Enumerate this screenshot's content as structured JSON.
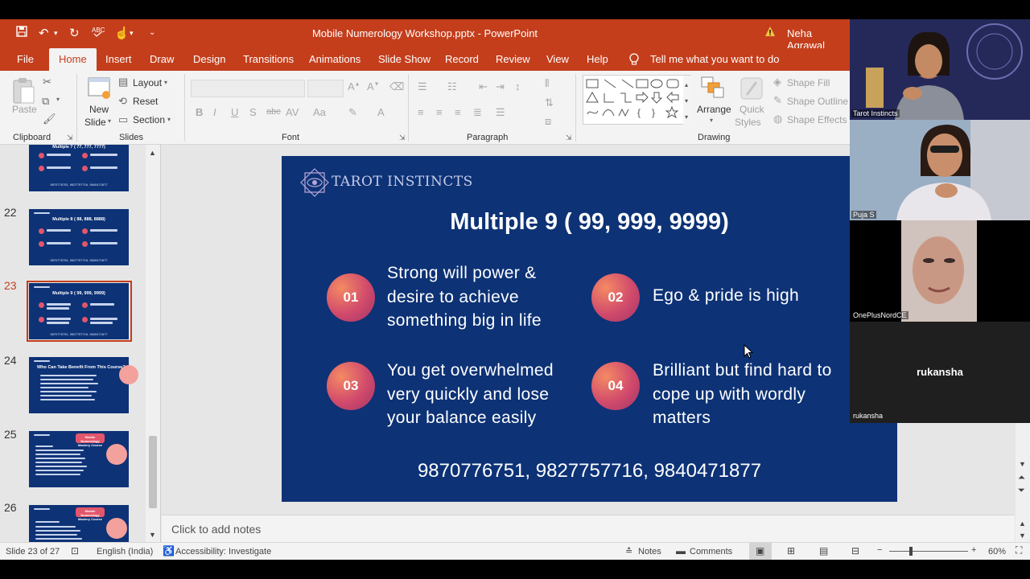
{
  "window": {
    "doc_title": "Mobile Numerology Workshop.pptx  -  PowerPoint",
    "user_name": "Neha Agrawal"
  },
  "tabs": [
    "File",
    "Home",
    "Insert",
    "Draw",
    "Design",
    "Transitions",
    "Animations",
    "Slide Show",
    "Record",
    "Review",
    "View",
    "Help"
  ],
  "tell_me": "Tell me what you want to do",
  "ribbon": {
    "clipboard": {
      "paste": "Paste",
      "label": "Clipboard"
    },
    "slides": {
      "new_slide_1": "New",
      "new_slide_2": "Slide",
      "layout": "Layout",
      "reset": "Reset",
      "section": "Section",
      "label": "Slides"
    },
    "font": {
      "label": "Font"
    },
    "paragraph": {
      "label": "Paragraph"
    },
    "drawing": {
      "arrange": "Arrange",
      "quick_styles_1": "Quick",
      "quick_styles_2": "Styles",
      "shape_fill": "Shape Fill",
      "shape_outline": "Shape Outline",
      "shape_effects": "Shape Effects",
      "label": "Drawing"
    }
  },
  "thumbnails": [
    {
      "number": "",
      "title": "Multiple 7 ( 77, 777, 7777)",
      "phones": "9870776751, 9827757716, 9840471877"
    },
    {
      "number": "22",
      "title": "Multiple 8 ( 88, 888, 8888)",
      "phones": "9870776751, 9827757716, 9840471877"
    },
    {
      "number": "23",
      "title": "Multiple 9 ( 99, 999, 9999)",
      "phones": "9870776751, 9827757716, 9840471877"
    },
    {
      "number": "24",
      "title": "Who Can Take Benefit From This Course?",
      "phones": ""
    },
    {
      "number": "25",
      "title": "Mobile Numerology Mastery Course",
      "phones": ""
    },
    {
      "number": "26",
      "title": "Mobile Numerology Mastery Course",
      "phones": ""
    }
  ],
  "slide": {
    "brand": "TAROT INSTINCTS",
    "title": "Multiple 9 ( 99, 999, 9999)",
    "items": [
      {
        "num": "01",
        "lines": [
          "Strong will power  &",
          "desire to achieve",
          "something big in life"
        ]
      },
      {
        "num": "02",
        "lines": [
          "Ego & pride is high"
        ]
      },
      {
        "num": "03",
        "lines": [
          "You get overwhelmed",
          "very quickly and lose",
          "your balance easily"
        ]
      },
      {
        "num": "04",
        "lines": [
          "Brilliant but find hard to",
          "cope up with wordly",
          "matters"
        ]
      }
    ],
    "phones": "9870776751, 9827757716, 9840471877"
  },
  "notes_placeholder": "Click to add notes",
  "status": {
    "slide_counter": "Slide 23 of 27",
    "language": "English (India)",
    "accessibility": "Accessibility: Investigate",
    "notes": "Notes",
    "comments": "Comments",
    "zoom": "60%"
  },
  "participants": [
    {
      "name": "Tarot Instincts"
    },
    {
      "name": "Puja S"
    },
    {
      "name": "OnePlusNordCE"
    },
    {
      "name": "rukansha",
      "big": "rukansha"
    }
  ],
  "colors": {
    "accent": "#c43e1c",
    "slide_bg": "#0d3276",
    "badge": "#d14a6c"
  }
}
